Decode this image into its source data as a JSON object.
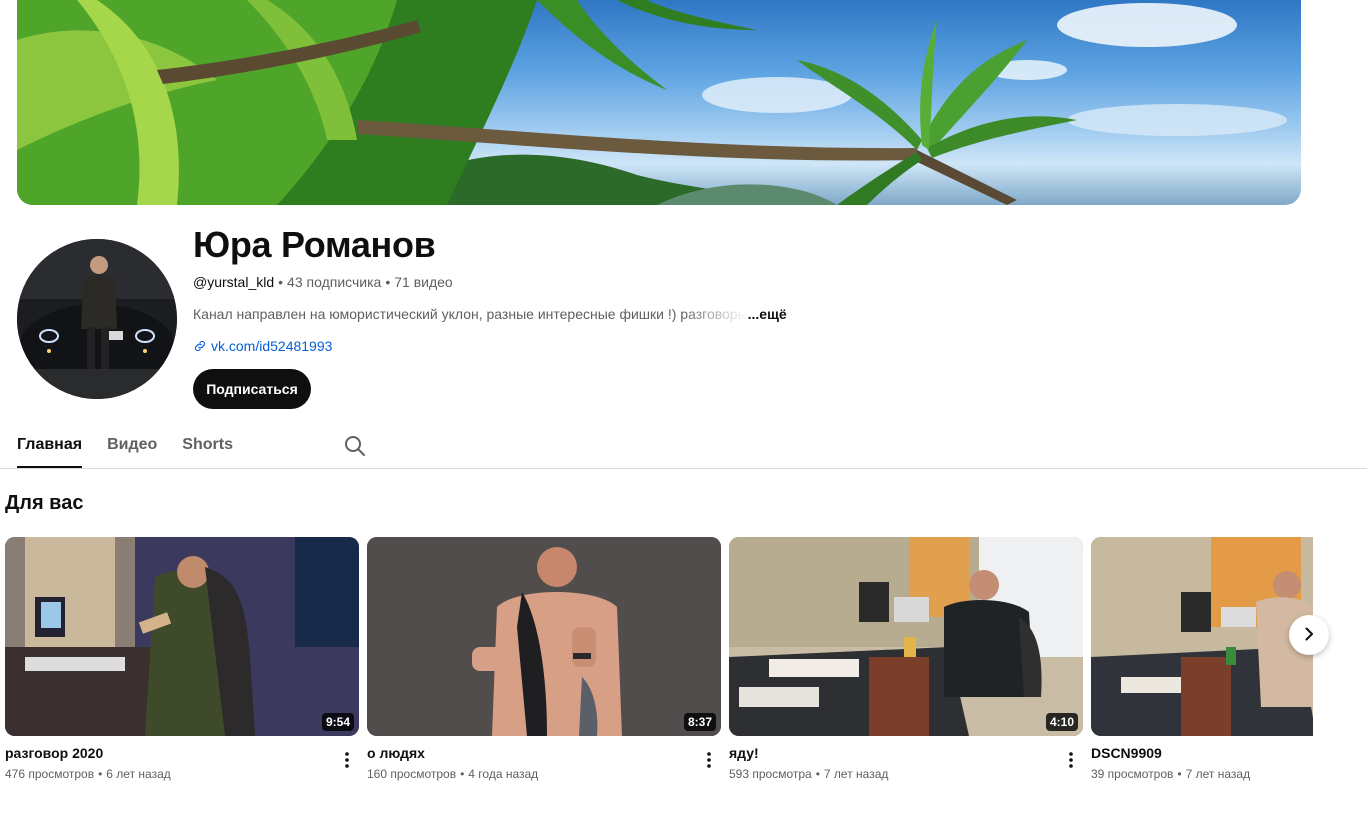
{
  "channel": {
    "name": "Юра Романов",
    "handle": "@yurstal_kld",
    "subscribers": "43 подписчика",
    "videos_count": "71 видео",
    "separator": "•",
    "description": "Канал направлен на юмористический уклон,  разные интересные фишки !) разговоры",
    "more_label": "...ещё",
    "link": "vk.com/id52481993",
    "subscribe_label": "Подписаться"
  },
  "tabs": [
    {
      "label": "Главная",
      "active": true
    },
    {
      "label": "Видео",
      "active": false
    },
    {
      "label": "Shorts",
      "active": false
    }
  ],
  "section": {
    "title": "Для вас"
  },
  "videos": [
    {
      "title": "разговор 2020",
      "duration": "9:54",
      "views": "476 просмотров",
      "age": "6 лет назад"
    },
    {
      "title": "о людях",
      "duration": "8:37",
      "views": "160 просмотров",
      "age": "4 года назад"
    },
    {
      "title": "яду!",
      "duration": "4:10",
      "views": "593 просмотра",
      "age": "7 лет назад"
    },
    {
      "title": "DSCN9909",
      "duration": "",
      "views": "39 просмотров",
      "age": "7 лет назад"
    }
  ],
  "icons": {
    "link": "link-icon",
    "search": "search-icon",
    "menu": "more-vert-icon",
    "next": "chevron-right-icon"
  },
  "colors": {
    "link": "#065fd4",
    "subscribe_bg": "#0f0f0f",
    "muted_text": "#606060"
  }
}
